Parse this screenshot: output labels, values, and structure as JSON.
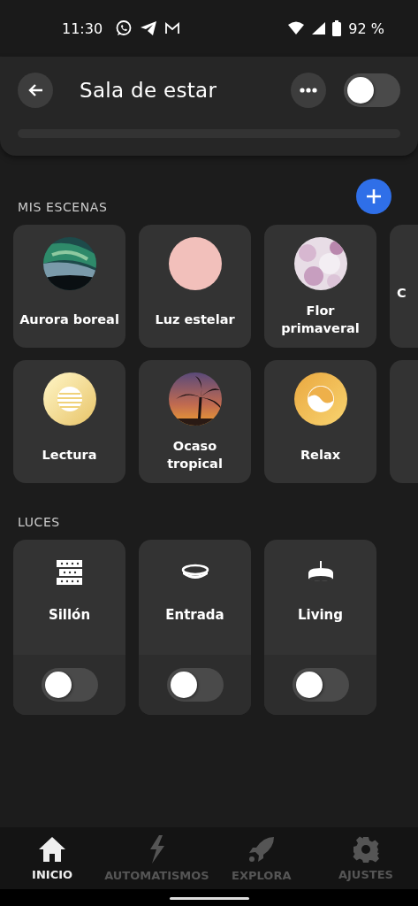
{
  "status_bar": {
    "time": "11:30",
    "battery": "92 %"
  },
  "header": {
    "title": "Sala de estar",
    "on": false,
    "brightness": {
      "level": 0
    }
  },
  "scenes_section": {
    "title": "MIS ESCENAS"
  },
  "scenes": [
    {
      "name": "Aurora boreal",
      "kind": "picture"
    },
    {
      "name": "Luz estelar",
      "kind": "color",
      "color": "#f2c0bb"
    },
    {
      "name": "Flor primaveral",
      "kind": "picture"
    },
    {
      "name": "C"
    },
    {
      "name": "Lectura",
      "kind": "icon"
    },
    {
      "name": "Ocaso tropical",
      "kind": "picture"
    },
    {
      "name": "Relax",
      "kind": "icon"
    }
  ],
  "lights_section": {
    "title": "LUCES"
  },
  "lights": [
    {
      "name": "Sillón",
      "kind": "strip",
      "on": false
    },
    {
      "name": "Entrada",
      "kind": "ring",
      "on": false
    },
    {
      "name": "Living",
      "kind": "pendant",
      "on": false
    }
  ],
  "nav": [
    {
      "label": "INICIO",
      "selected": true
    },
    {
      "label": "AUTOMATISMOS",
      "selected": false
    },
    {
      "label": "EXPLORA",
      "selected": false
    },
    {
      "label": "AJUSTES",
      "selected": false
    }
  ]
}
